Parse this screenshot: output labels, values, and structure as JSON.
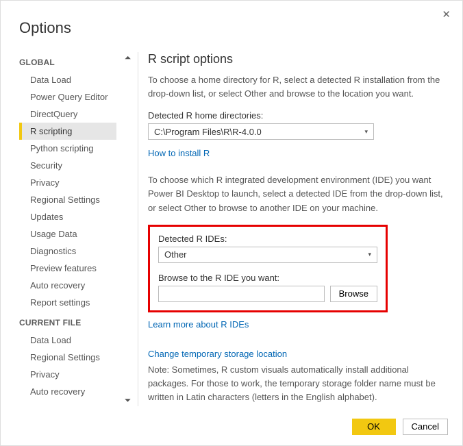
{
  "window": {
    "title": "Options"
  },
  "sidebar": {
    "global_header": "GLOBAL",
    "current_file_header": "CURRENT FILE",
    "global_items": [
      "Data Load",
      "Power Query Editor",
      "DirectQuery",
      "R scripting",
      "Python scripting",
      "Security",
      "Privacy",
      "Regional Settings",
      "Updates",
      "Usage Data",
      "Diagnostics",
      "Preview features",
      "Auto recovery",
      "Report settings"
    ],
    "current_file_items": [
      "Data Load",
      "Regional Settings",
      "Privacy",
      "Auto recovery"
    ],
    "selected_index": 3
  },
  "panel": {
    "heading": "R script options",
    "intro": "To choose a home directory for R, select a detected R installation from the drop-down list, or select Other and browse to the location you want.",
    "home_label": "Detected R home directories:",
    "home_value": "C:\\Program Files\\R\\R-4.0.0",
    "how_to_install": "How to install R",
    "ide_intro": "To choose which R integrated development environment (IDE) you want Power BI Desktop to launch, select a detected IDE from the drop-down list, or select Other to browse to another IDE on your machine.",
    "ide_label": "Detected R IDEs:",
    "ide_value": "Other",
    "browse_label": "Browse to the R IDE you want:",
    "browse_value": "",
    "browse_button": "Browse",
    "learn_more": "Learn more about R IDEs",
    "change_temp": "Change temporary storage location",
    "note": "Note: Sometimes, R custom visuals automatically install additional packages. For those to work, the temporary storage folder name must be written in Latin characters (letters in the English alphabet)."
  },
  "footer": {
    "ok": "OK",
    "cancel": "Cancel"
  }
}
